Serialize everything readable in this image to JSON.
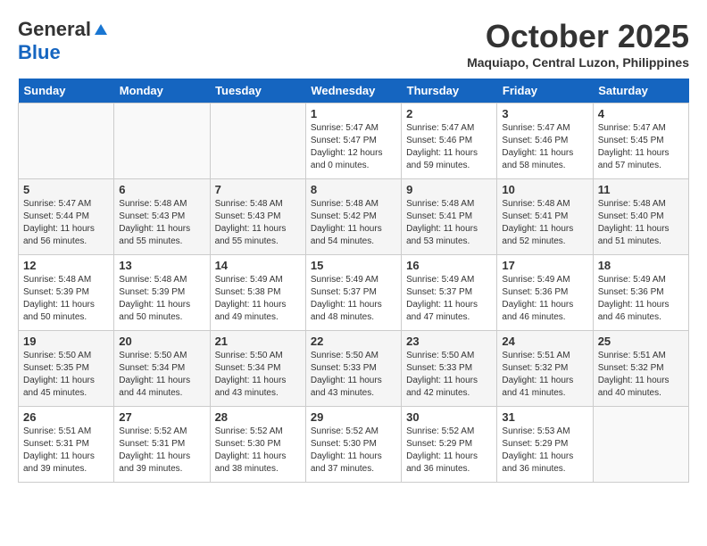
{
  "header": {
    "logo_general": "General",
    "logo_blue": "Blue",
    "month_title": "October 2025",
    "location": "Maquiapo, Central Luzon, Philippines"
  },
  "days_of_week": [
    "Sunday",
    "Monday",
    "Tuesday",
    "Wednesday",
    "Thursday",
    "Friday",
    "Saturday"
  ],
  "weeks": [
    [
      {
        "day": "",
        "info": ""
      },
      {
        "day": "",
        "info": ""
      },
      {
        "day": "",
        "info": ""
      },
      {
        "day": "1",
        "info": "Sunrise: 5:47 AM\nSunset: 5:47 PM\nDaylight: 12 hours\nand 0 minutes."
      },
      {
        "day": "2",
        "info": "Sunrise: 5:47 AM\nSunset: 5:46 PM\nDaylight: 11 hours\nand 59 minutes."
      },
      {
        "day": "3",
        "info": "Sunrise: 5:47 AM\nSunset: 5:46 PM\nDaylight: 11 hours\nand 58 minutes."
      },
      {
        "day": "4",
        "info": "Sunrise: 5:47 AM\nSunset: 5:45 PM\nDaylight: 11 hours\nand 57 minutes."
      }
    ],
    [
      {
        "day": "5",
        "info": "Sunrise: 5:47 AM\nSunset: 5:44 PM\nDaylight: 11 hours\nand 56 minutes."
      },
      {
        "day": "6",
        "info": "Sunrise: 5:48 AM\nSunset: 5:43 PM\nDaylight: 11 hours\nand 55 minutes."
      },
      {
        "day": "7",
        "info": "Sunrise: 5:48 AM\nSunset: 5:43 PM\nDaylight: 11 hours\nand 55 minutes."
      },
      {
        "day": "8",
        "info": "Sunrise: 5:48 AM\nSunset: 5:42 PM\nDaylight: 11 hours\nand 54 minutes."
      },
      {
        "day": "9",
        "info": "Sunrise: 5:48 AM\nSunset: 5:41 PM\nDaylight: 11 hours\nand 53 minutes."
      },
      {
        "day": "10",
        "info": "Sunrise: 5:48 AM\nSunset: 5:41 PM\nDaylight: 11 hours\nand 52 minutes."
      },
      {
        "day": "11",
        "info": "Sunrise: 5:48 AM\nSunset: 5:40 PM\nDaylight: 11 hours\nand 51 minutes."
      }
    ],
    [
      {
        "day": "12",
        "info": "Sunrise: 5:48 AM\nSunset: 5:39 PM\nDaylight: 11 hours\nand 50 minutes."
      },
      {
        "day": "13",
        "info": "Sunrise: 5:48 AM\nSunset: 5:39 PM\nDaylight: 11 hours\nand 50 minutes."
      },
      {
        "day": "14",
        "info": "Sunrise: 5:49 AM\nSunset: 5:38 PM\nDaylight: 11 hours\nand 49 minutes."
      },
      {
        "day": "15",
        "info": "Sunrise: 5:49 AM\nSunset: 5:37 PM\nDaylight: 11 hours\nand 48 minutes."
      },
      {
        "day": "16",
        "info": "Sunrise: 5:49 AM\nSunset: 5:37 PM\nDaylight: 11 hours\nand 47 minutes."
      },
      {
        "day": "17",
        "info": "Sunrise: 5:49 AM\nSunset: 5:36 PM\nDaylight: 11 hours\nand 46 minutes."
      },
      {
        "day": "18",
        "info": "Sunrise: 5:49 AM\nSunset: 5:36 PM\nDaylight: 11 hours\nand 46 minutes."
      }
    ],
    [
      {
        "day": "19",
        "info": "Sunrise: 5:50 AM\nSunset: 5:35 PM\nDaylight: 11 hours\nand 45 minutes."
      },
      {
        "day": "20",
        "info": "Sunrise: 5:50 AM\nSunset: 5:34 PM\nDaylight: 11 hours\nand 44 minutes."
      },
      {
        "day": "21",
        "info": "Sunrise: 5:50 AM\nSunset: 5:34 PM\nDaylight: 11 hours\nand 43 minutes."
      },
      {
        "day": "22",
        "info": "Sunrise: 5:50 AM\nSunset: 5:33 PM\nDaylight: 11 hours\nand 43 minutes."
      },
      {
        "day": "23",
        "info": "Sunrise: 5:50 AM\nSunset: 5:33 PM\nDaylight: 11 hours\nand 42 minutes."
      },
      {
        "day": "24",
        "info": "Sunrise: 5:51 AM\nSunset: 5:32 PM\nDaylight: 11 hours\nand 41 minutes."
      },
      {
        "day": "25",
        "info": "Sunrise: 5:51 AM\nSunset: 5:32 PM\nDaylight: 11 hours\nand 40 minutes."
      }
    ],
    [
      {
        "day": "26",
        "info": "Sunrise: 5:51 AM\nSunset: 5:31 PM\nDaylight: 11 hours\nand 39 minutes."
      },
      {
        "day": "27",
        "info": "Sunrise: 5:52 AM\nSunset: 5:31 PM\nDaylight: 11 hours\nand 39 minutes."
      },
      {
        "day": "28",
        "info": "Sunrise: 5:52 AM\nSunset: 5:30 PM\nDaylight: 11 hours\nand 38 minutes."
      },
      {
        "day": "29",
        "info": "Sunrise: 5:52 AM\nSunset: 5:30 PM\nDaylight: 11 hours\nand 37 minutes."
      },
      {
        "day": "30",
        "info": "Sunrise: 5:52 AM\nSunset: 5:29 PM\nDaylight: 11 hours\nand 36 minutes."
      },
      {
        "day": "31",
        "info": "Sunrise: 5:53 AM\nSunset: 5:29 PM\nDaylight: 11 hours\nand 36 minutes."
      },
      {
        "day": "",
        "info": ""
      }
    ]
  ]
}
